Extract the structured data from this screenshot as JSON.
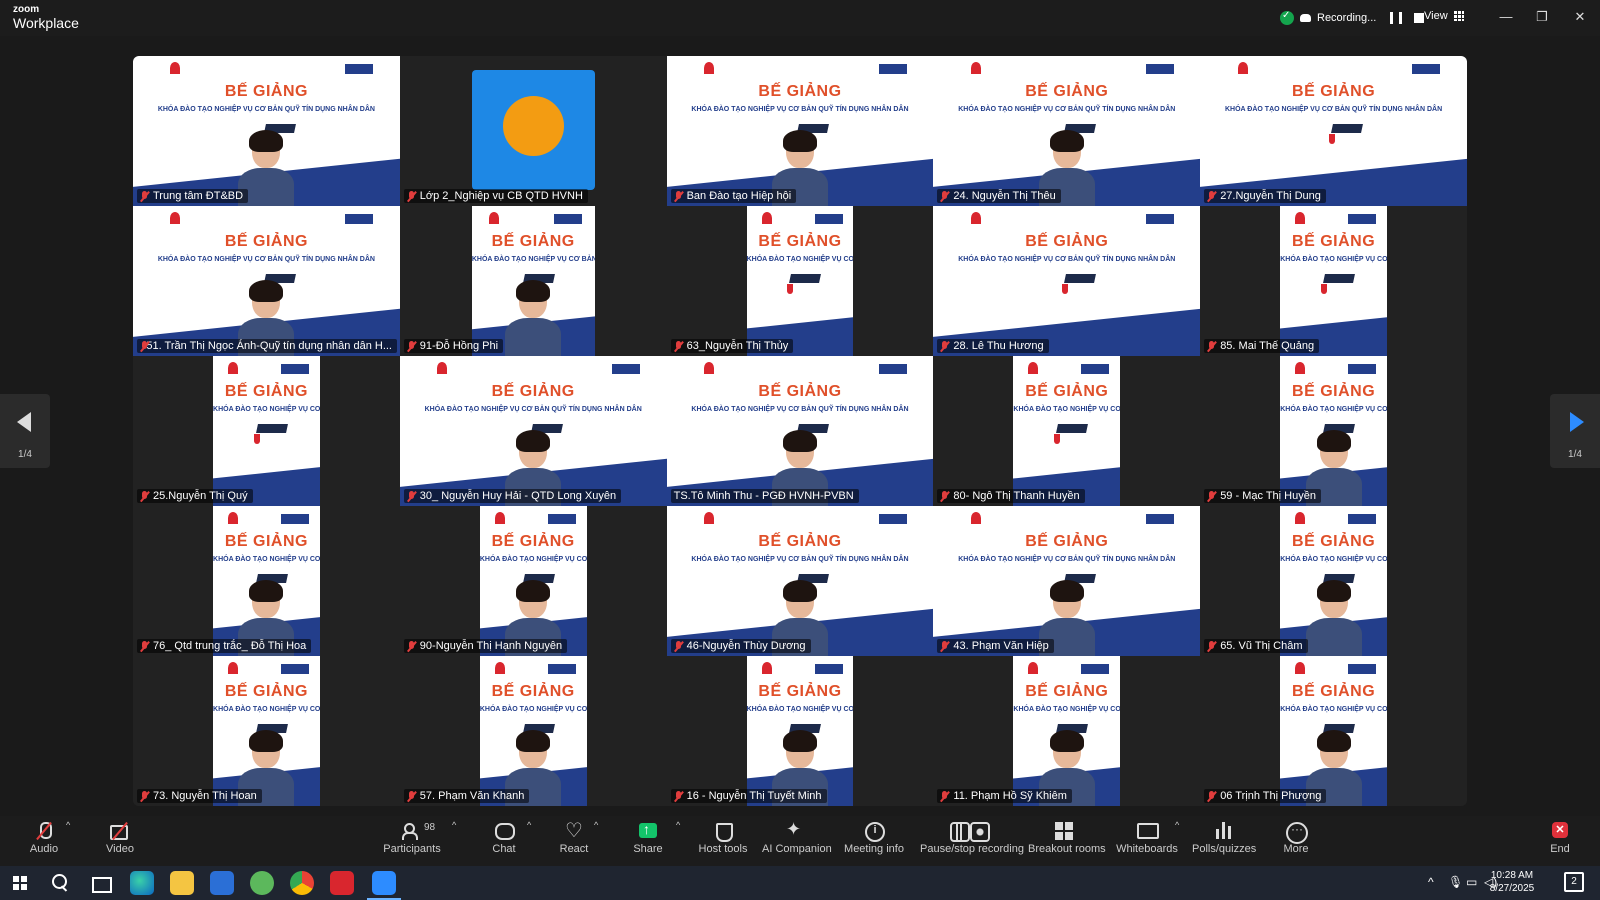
{
  "app": {
    "brand_line1": "zoom",
    "brand_line2": "Workplace"
  },
  "recording": {
    "label": "Recording..."
  },
  "view": {
    "label": "View"
  },
  "window_controls": {
    "minimize": "—",
    "restore": "❐",
    "close": "✕"
  },
  "pager": {
    "left_label": "1/4",
    "right_label": "1/4"
  },
  "tiles": [
    {
      "name": "Trung tâm ĐT&BD",
      "kind": "banner-person"
    },
    {
      "name": "Lớp 2_Nghiệp vụ CB QTD HVNH",
      "kind": "logo"
    },
    {
      "name": "Ban Đào tạo Hiệp hội",
      "kind": "banner-person"
    },
    {
      "name": "24. Nguyễn Thị Thêu",
      "kind": "banner-person"
    },
    {
      "name": "27.Nguyễn Thị Dung",
      "kind": "banner"
    },
    {
      "name": "51. Trần Thị Ngọc Ánh-Quỹ tín dụng nhân dân H...",
      "kind": "banner-person"
    },
    {
      "name": "91-Đỗ Hồng Phi",
      "kind": "narrow-person"
    },
    {
      "name": "63_Nguyễn Thị Thủy",
      "kind": "slim"
    },
    {
      "name": "28. Lê Thu Hương",
      "kind": "banner"
    },
    {
      "name": "85. Mai Thế Quảng",
      "kind": "slim"
    },
    {
      "name": "25.Nguyễn Thị Quý",
      "kind": "slim"
    },
    {
      "name": "30_ Nguyễn Huy Hải - QTD Long Xuyên",
      "kind": "banner-person"
    },
    {
      "name": "TS.Tô Minh Thu - PGĐ HVNH-PVBN",
      "kind": "banner-person",
      "active": true
    },
    {
      "name": "80- Ngô Thị Thanh Huyền",
      "kind": "slim"
    },
    {
      "name": "59 - Mạc Thị Huyền",
      "kind": "slim-person"
    },
    {
      "name": "76_ Qtd trung trắc_ Đỗ Thị Hoa",
      "kind": "slim-person"
    },
    {
      "name": "90-Nguyễn Thị Hạnh Nguyên",
      "kind": "slim-person"
    },
    {
      "name": "46-Nguyễn Thùy Dương",
      "kind": "banner-person"
    },
    {
      "name": "43. Phạm Văn Hiệp",
      "kind": "banner-person"
    },
    {
      "name": "65. Vũ Thị Châm",
      "kind": "slim-person"
    },
    {
      "name": "73. Nguyễn Thị Hoan",
      "kind": "slim-person"
    },
    {
      "name": "57. Phạm Văn Khanh",
      "kind": "slim-person"
    },
    {
      "name": "16 - Nguyễn Thị Tuyết Minh",
      "kind": "slim-person"
    },
    {
      "name": "11. Phạm Hồ Sỹ Khiêm",
      "kind": "slim-person"
    },
    {
      "name": "06 Trịnh Thị Phượng",
      "kind": "slim-person"
    }
  ],
  "banner": {
    "title": "BẾ GIẢNG",
    "subtitle": "KHÓA ĐÀO TẠO NGHIỆP VỤ CƠ BẢN QUỸ TÍN DỤNG NHÂN DÂN"
  },
  "toolbar": {
    "audio": "Audio",
    "video": "Video",
    "participants": "Participants",
    "participants_count": "98",
    "chat": "Chat",
    "react": "React",
    "share": "Share",
    "host_tools": "Host tools",
    "ai_companion": "AI Companion",
    "meeting_info": "Meeting info",
    "pause_stop": "Pause/stop recording",
    "breakout": "Breakout rooms",
    "whiteboards": "Whiteboards",
    "polls": "Polls/quizzes",
    "more": "More",
    "end": "End"
  },
  "taskbar": {
    "time": "10:28 AM",
    "date": "8/27/2025",
    "notifications": "2"
  },
  "colors": {
    "accent": "#2d8cff",
    "share_green": "#13c46a",
    "end_red": "#e0313b",
    "active_speaker": "#2ed573"
  }
}
